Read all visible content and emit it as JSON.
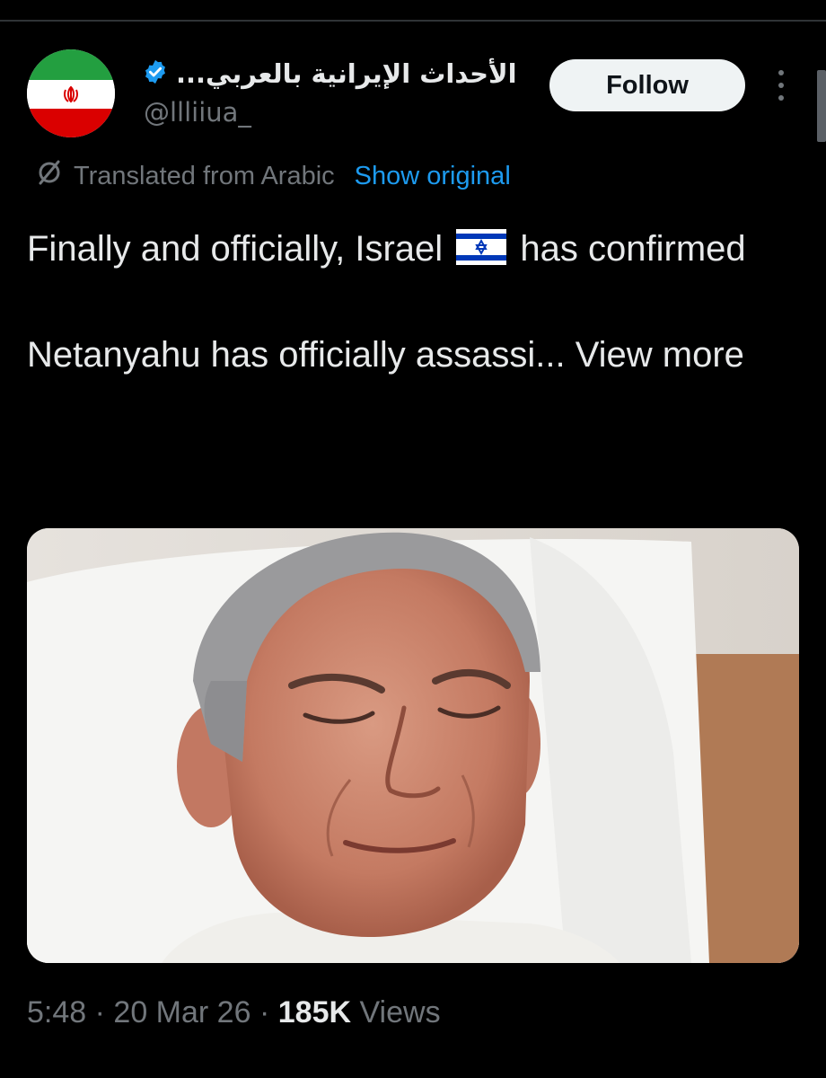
{
  "author": {
    "display_name": "الأحداث الإيرانية بالعربي...",
    "handle": "@llliiua_",
    "verified": true,
    "avatar_icon": "iran-flag-avatar"
  },
  "actions": {
    "follow_label": "Follow",
    "more_icon": "more-vertical-icon"
  },
  "translation": {
    "icon": "translate-icon",
    "label": "Translated from Arabic",
    "show_original": "Show original"
  },
  "tweet": {
    "line1_before_flag": "Finally and officially, Israel",
    "flag_icon": "israel-flag-emoji",
    "line1_after_flag": "has confirmed",
    "line2": "Netanyahu has officially assassi...",
    "view_more": "View more"
  },
  "media": {
    "icon": "photo-netanyahu-hospital-bed"
  },
  "meta": {
    "time": "5:48",
    "sep1": "·",
    "date": "20 Mar 26",
    "sep2": "·",
    "views_count": "185K",
    "views_label": "Views"
  },
  "colors": {
    "background": "#000000",
    "text": "#e7e9ea",
    "muted": "#71767b",
    "link": "#1d9bf0",
    "verified": "#1d9bf0",
    "follow_bg": "#eff3f4"
  }
}
